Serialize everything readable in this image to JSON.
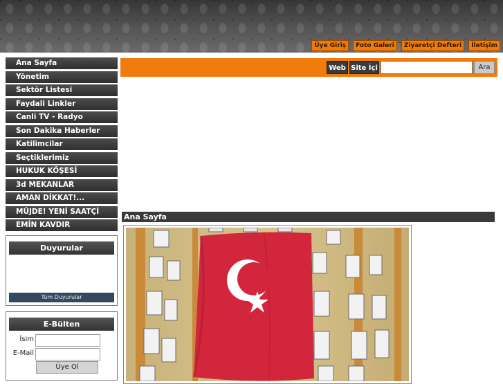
{
  "header": {
    "links": [
      "Üye Giriş",
      "Foto Galeri",
      "Ziyaretçi Defteri",
      "İletişim"
    ]
  },
  "menu": {
    "items": [
      "Ana Sayfa",
      "Yönetim",
      "Sektör Listesi",
      "Faydali Linkler",
      "Canli TV - Radyo",
      "Son Dakika Haberler",
      "Katilimcilar",
      "Seçtiklerimiz",
      "HUKUK KÖŞESİ",
      "3d MEKANLAR",
      "AMAN DİKKAT!...",
      "MÜJDE! YENİ SAATÇİ",
      "EMİN KAVDIR"
    ]
  },
  "announcements": {
    "title": "Duyurular",
    "all_label": "Tüm Duyurular"
  },
  "newsletter": {
    "title": "E-Bülten",
    "name_label": "İsim",
    "name_value": "",
    "email_label": "E-Mail",
    "email_value": "",
    "submit_label": "Üye Ol"
  },
  "search": {
    "web_label": "Web",
    "site_label": "Site İçi",
    "value": "",
    "button_label": "Ara"
  },
  "content": {
    "title": "Ana Sayfa"
  },
  "colors": {
    "accent": "#f17c0e",
    "menu_bg": "#3a3a3a",
    "flag": "#d2263c"
  }
}
